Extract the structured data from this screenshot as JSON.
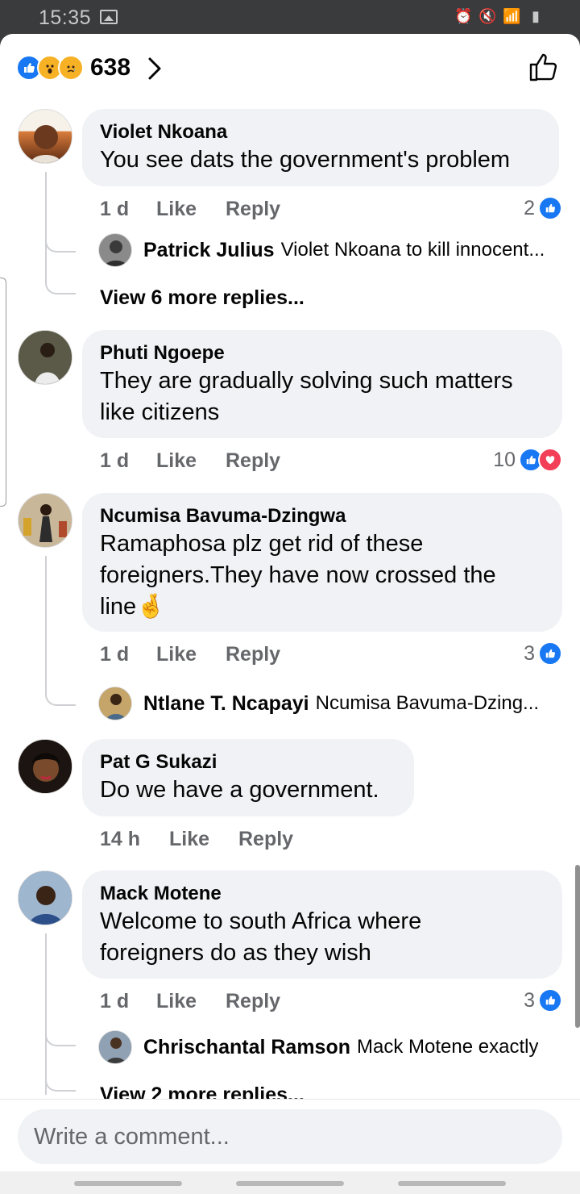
{
  "status": {
    "time": "15:35"
  },
  "header": {
    "reaction_count": "638"
  },
  "comments": [
    {
      "author": "Violet Nkoana",
      "text": "You see dats the government's problem",
      "age": "1 d",
      "like_label": "Like",
      "reply_label": "Reply",
      "likes": "2",
      "reply_preview": {
        "author": "Patrick Julius",
        "text": "Violet Nkoana to kill innocent..."
      },
      "view_more": "View 6 more replies..."
    },
    {
      "author": "Phuti Ngoepe",
      "text_lines": [
        "They are gradually solving such matters",
        "like citizens"
      ],
      "age": "1 d",
      "like_label": "Like",
      "reply_label": "Reply",
      "likes": "10"
    },
    {
      "author": "Ncumisa Bavuma-Dzingwa",
      "text_lines": [
        "Ramaphosa plz get rid of these",
        "foreigners.They have now crossed the",
        "line"
      ],
      "emoji": "🤞",
      "age": "1 d",
      "like_label": "Like",
      "reply_label": "Reply",
      "likes": "3",
      "reply_preview": {
        "author": "Ntlane T. Ncapayi",
        "text": "Ncumisa Bavuma-Dzing..."
      }
    },
    {
      "author": "Pat G Sukazi",
      "text": "Do we have a government.",
      "age": "14 h",
      "like_label": "Like",
      "reply_label": "Reply"
    },
    {
      "author": "Mack Motene",
      "text_lines": [
        "Welcome to south Africa where",
        "foreigners do as they wish"
      ],
      "age": "1 d",
      "like_label": "Like",
      "reply_label": "Reply",
      "likes": "3",
      "reply_preview": {
        "author": "Chrischantal Ramson",
        "text": "Mack Motene exactly"
      },
      "view_more": "View 2 more replies..."
    }
  ],
  "composer": {
    "placeholder": "Write a comment..."
  },
  "icons": {
    "reactions": [
      "like-reaction-icon",
      "wow-reaction-icon",
      "sad-reaction-icon"
    ],
    "like_badge": "like-badge-icon",
    "love_badge": "love-badge-icon"
  },
  "colors": {
    "facebook_blue": "#1877f2",
    "love_red": "#f33e58",
    "bubble_gray": "#f0f2f5",
    "meta_gray": "#65676b"
  }
}
